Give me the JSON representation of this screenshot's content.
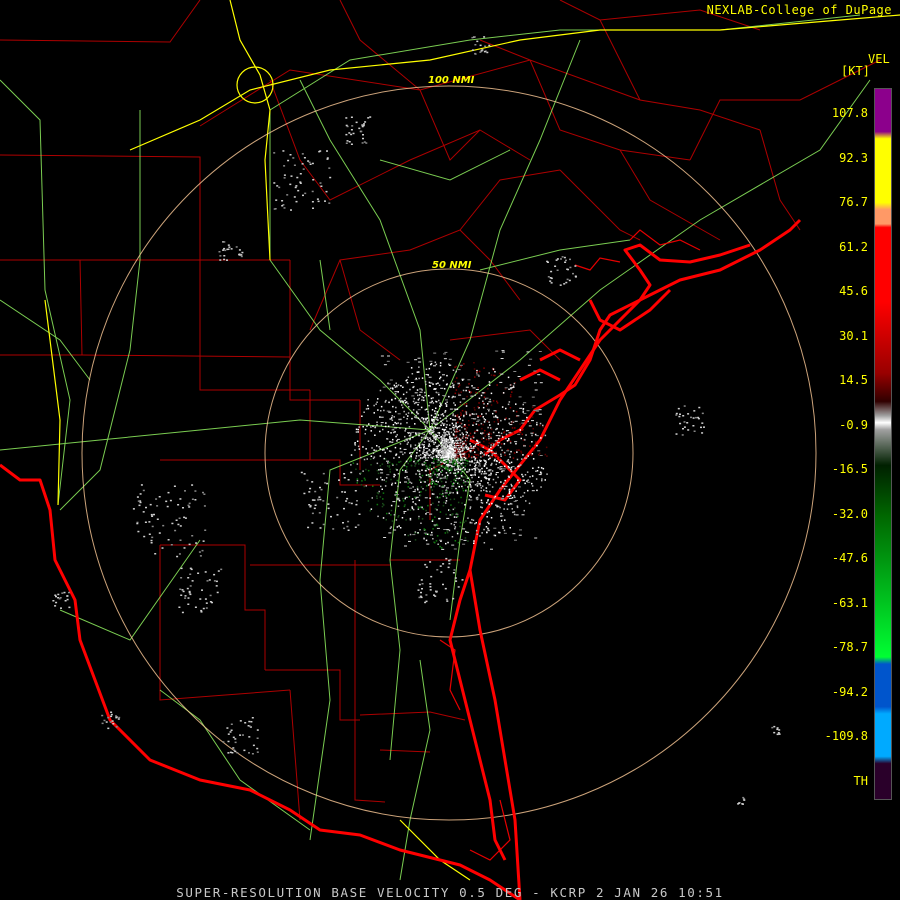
{
  "header": {
    "credit": "NEXLAB-College of DuPage",
    "product": "VEL",
    "unit": "[KT]"
  },
  "rings": [
    {
      "label": "100 NMI"
    },
    {
      "label": "50 NMI"
    }
  ],
  "legend": {
    "labels": [
      "107.8",
      "92.3",
      "76.7",
      "61.2",
      "45.6",
      "30.1",
      "14.5",
      "-0.9",
      "-16.5",
      "-32.0",
      "-47.6",
      "-63.1",
      "-78.7",
      "-94.2",
      "-109.8",
      "TH"
    ],
    "colors": {
      "purple": "#8c008c",
      "yellow": "#ffff00",
      "orange": "#ff9966",
      "red": "#ff0000",
      "darkred": "#990000",
      "gray": "#a0a0a0",
      "darkgreen": "#006600",
      "green": "#00ff33",
      "blue": "#0055cc",
      "lightblue": "#00aaff",
      "th": "#2a002a"
    }
  },
  "footer": {
    "caption": "SUPER-RESOLUTION BASE VELOCITY 0.5 DEG - KCRP 2 JAN 26 10:51"
  },
  "map_colors": {
    "county_lines": "#cc0000",
    "highways": "#99ff66",
    "interstates": "#ffff00",
    "coastline": "#ff0000",
    "range_rings": "#ffcc99"
  }
}
